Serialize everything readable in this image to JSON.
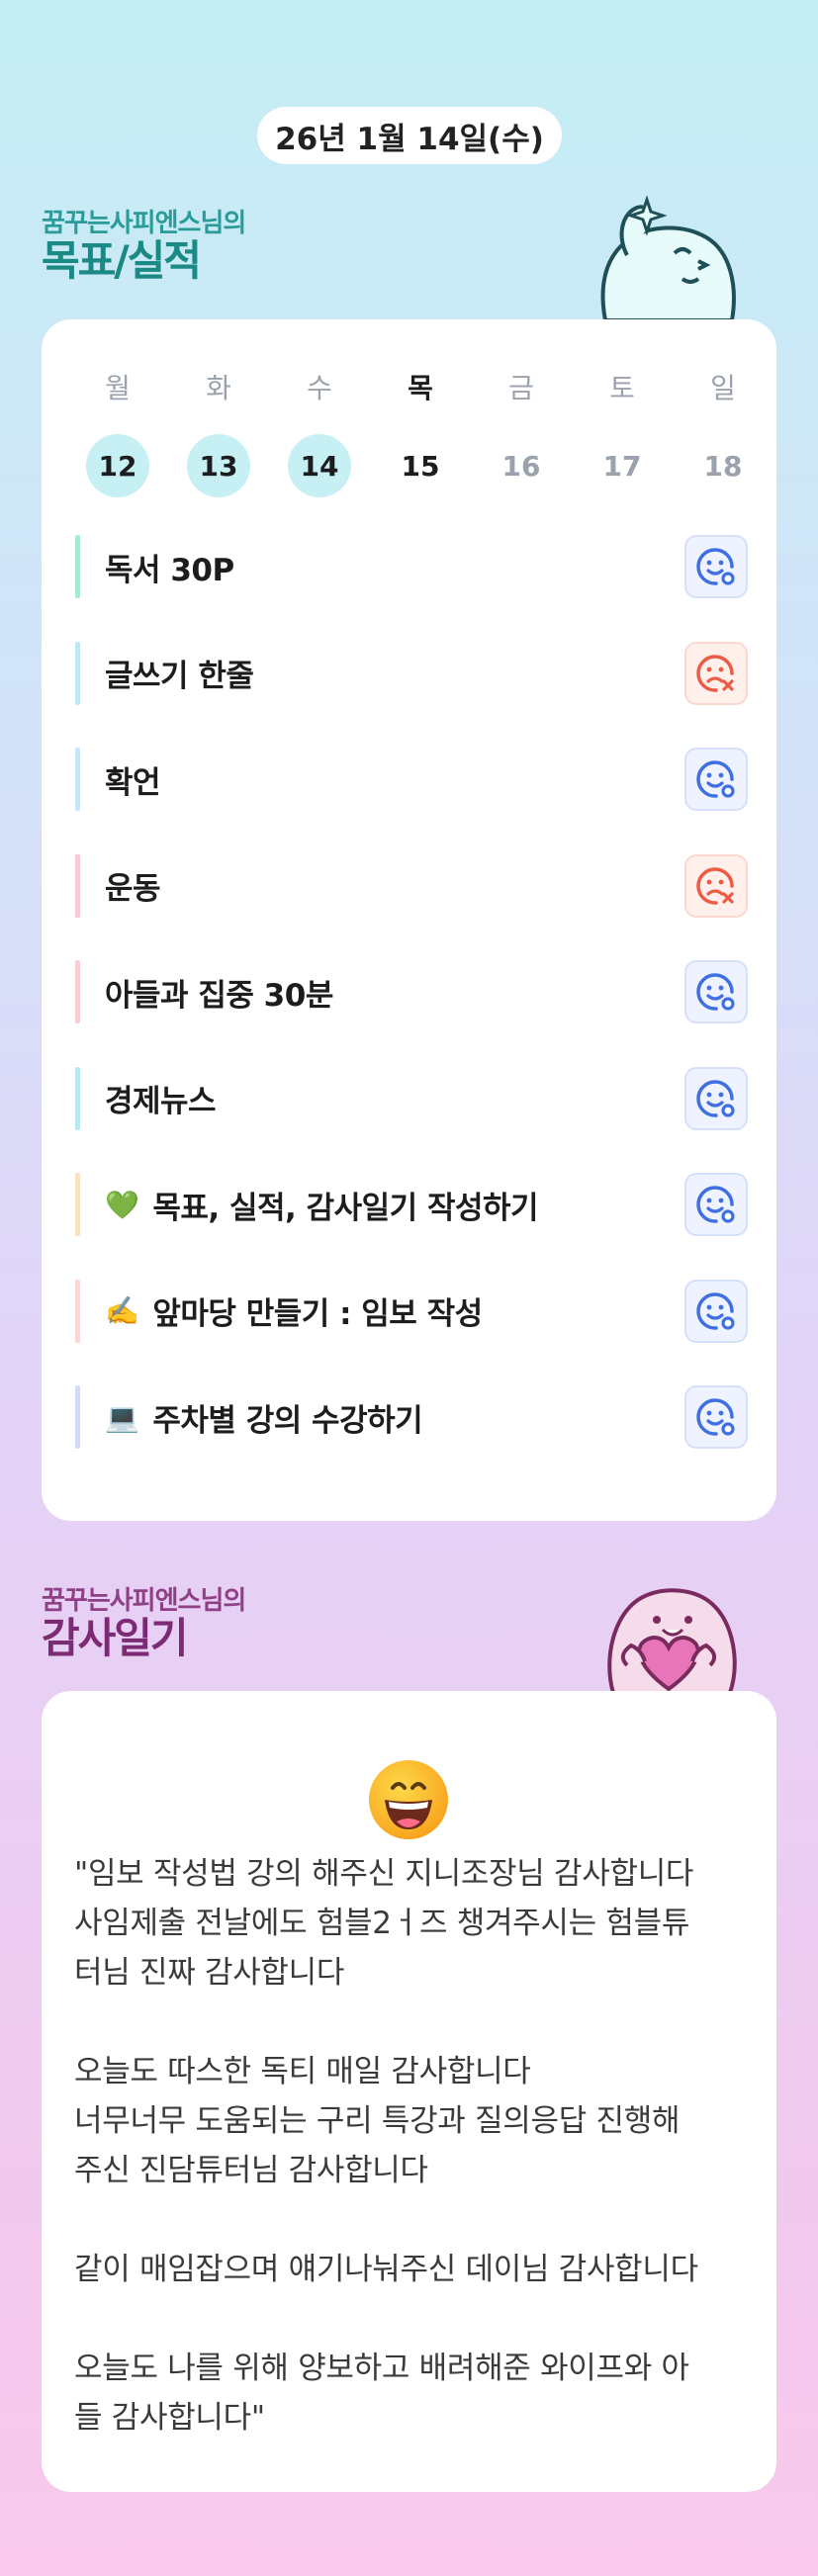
{
  "date_label": "26년 1월 14일(수)",
  "goals_section": {
    "subtitle": "꿈꾸는사피엔스님의",
    "title": "목표/실적"
  },
  "week": [
    {
      "name": "월",
      "num": "12",
      "state": "done"
    },
    {
      "name": "화",
      "num": "13",
      "state": "done"
    },
    {
      "name": "수",
      "num": "14",
      "state": "done"
    },
    {
      "name": "목",
      "num": "15",
      "state": "today"
    },
    {
      "name": "금",
      "num": "16",
      "state": "future"
    },
    {
      "name": "토",
      "num": "17",
      "state": "future"
    },
    {
      "name": "일",
      "num": "18",
      "state": "future"
    }
  ],
  "goals": [
    {
      "emoji": "",
      "label": "독서 30P",
      "status": "done",
      "bar_color": "#a9e8d4"
    },
    {
      "emoji": "",
      "label": "글쓰기 한줄",
      "status": "missed",
      "bar_color": "#bfe7f7"
    },
    {
      "emoji": "",
      "label": "확언",
      "status": "done",
      "bar_color": "#c4e6f8"
    },
    {
      "emoji": "",
      "label": "운동",
      "status": "missed",
      "bar_color": "#f6c9dc"
    },
    {
      "emoji": "",
      "label": "아들과 집중 30분",
      "status": "done",
      "bar_color": "#f8d0d4"
    },
    {
      "emoji": "",
      "label": "경제뉴스",
      "status": "done",
      "bar_color": "#b8e9f2"
    },
    {
      "emoji": "💚",
      "label": "목표, 실적, 감사일기 작성하기",
      "status": "done",
      "bar_color": "#fbe0c0"
    },
    {
      "emoji": "✍️",
      "label": "앞마당 만들기 : 임보 작성",
      "status": "done",
      "bar_color": "#fbd6d6"
    },
    {
      "emoji": "💻",
      "label": "주차별 강의 수강하기",
      "status": "done",
      "bar_color": "#d3dafa"
    }
  ],
  "gratitude_section": {
    "subtitle": "꿈꾸는사피엔스님의",
    "title": "감사일기"
  },
  "gratitude": {
    "mood_icon": "grinning-face-icon",
    "text": "\"임보 작성법 강의 해주신 지니조장님 감사합니다\n사임제출 전날에도 험블2ㅓ즈 챙겨주시는 험블튜\n터님 진짜 감사합니다\n\n오늘도 따스한 독티 매일 감사합니다\n너무너무 도움되는 구리 특강과 질의응답 진행해\n주신 진담튜터님 감사합니다\n\n같이 매임잡으며 얘기나눠주신 데이님 감사합니다\n\n오늘도 나를 위해 양보하고 배려해준 와이프와 아\n들 감사합니다\""
  },
  "colors": {
    "done_icon": "#3f6fe3",
    "missed_icon": "#ee5b45",
    "teal": "#1b8a85",
    "purple": "#7c2a73"
  }
}
